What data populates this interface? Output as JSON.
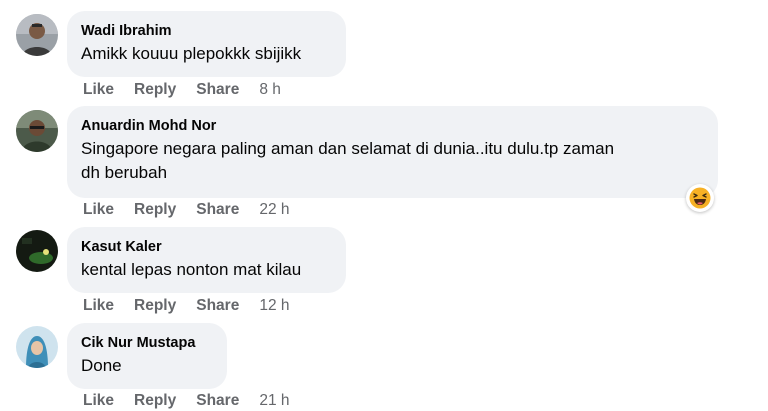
{
  "colors": {
    "bubble": "#f0f2f5",
    "action_text": "#65676b",
    "name_text": "#050505",
    "reaction_yellow": "#f7b125"
  },
  "comments": [
    {
      "author": "Wadi Ibrahim",
      "text": "Amikk kouuu plepokkk sbijikk",
      "actions": {
        "like": "Like",
        "reply": "Reply",
        "share": "Share"
      },
      "time": "8 h",
      "avatar_icon": "man-portrait-icon"
    },
    {
      "author": "Anuardin Mohd Nor",
      "text": "Singapore negara paling aman dan selamat di dunia..itu dulu.tp zaman\ndh berubah",
      "actions": {
        "like": "Like",
        "reply": "Reply",
        "share": "Share"
      },
      "time": "22 h",
      "avatar_icon": "man-portrait-icon",
      "reaction_icon": "haha-reaction-icon"
    },
    {
      "author": "Kasut Kaler",
      "text": "kental lepas nonton mat kilau",
      "actions": {
        "like": "Like",
        "reply": "Reply",
        "share": "Share"
      },
      "time": "12 h",
      "avatar_icon": "dark-scene-icon"
    },
    {
      "author": "Cik Nur Mustapa",
      "text": "Done",
      "actions": {
        "like": "Like",
        "reply": "Reply",
        "share": "Share"
      },
      "time": "21 h",
      "avatar_icon": "hijab-woman-icon"
    }
  ]
}
